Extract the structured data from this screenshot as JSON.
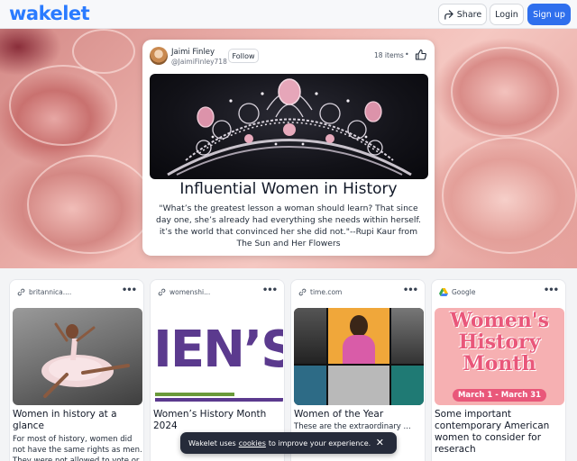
{
  "header": {
    "logo": "wakelet",
    "share_label": "Share",
    "login_label": "Login",
    "signup_label": "Sign up"
  },
  "collection": {
    "owner_name": "Jaimi Finley",
    "owner_handle": "@JaimiFinley718",
    "follow_label": "Follow",
    "item_count": "18 items",
    "title": "Influential Women in History",
    "quote": "\"What’s the greatest lesson a woman should learn? That since day one, she’s already had everything she needs within herself. it’s the world that convinced her she did not.\"--Rupi Kaur from The Sun and Her Flowers"
  },
  "items": [
    {
      "source": "britannica....",
      "title": "Women in history at a glance",
      "description": "For most of history, women did not have the same rights as men. They were not allowed to vote or"
    },
    {
      "source": "womenshi...",
      "title": "Women’s History Month 2024",
      "description": "",
      "image_text": "IEN’S"
    },
    {
      "source": "time.com",
      "title": "Women of the Year",
      "description": "These are the extraordinary ... ess ... and borders"
    },
    {
      "source": "Google",
      "title": "Some important contemporary American women to consider for reserach",
      "description": "",
      "image_title": "Women's History Month",
      "image_date": "March 1 - March 31"
    }
  ],
  "cookie_toast": {
    "text_before": "Wakelet uses",
    "link": "cookies",
    "text_after": "to improve your experience."
  },
  "colors": {
    "brand_blue": "#2a7bff",
    "signup_blue": "#2f6fed",
    "toast_bg": "#262b3a"
  }
}
